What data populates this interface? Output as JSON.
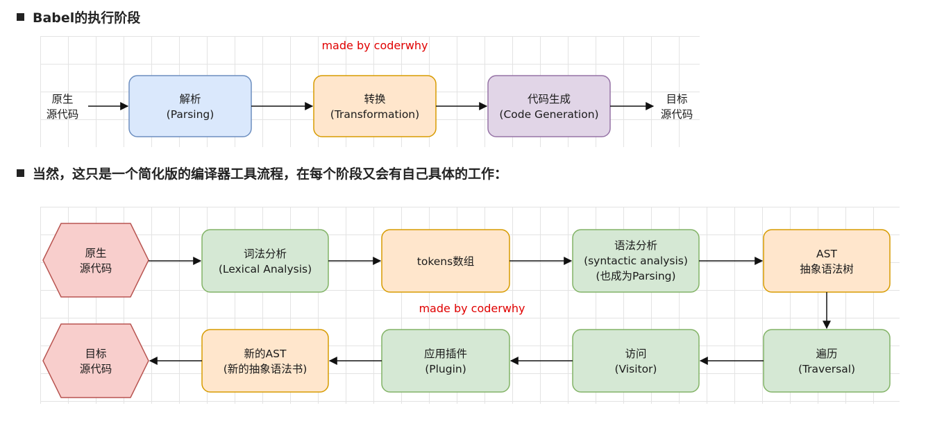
{
  "heading1": "Babel的执行阶段",
  "heading2": "当然，这只是一个简化版的编译器工具流程，在每个阶段又会有自己具体的工作：",
  "watermark": "made by coderwhy",
  "colors": {
    "blue_fill": "#dae8fc",
    "blue_stroke": "#6c8ebf",
    "orange_fill": "#ffe6cc",
    "orange_stroke": "#d79b00",
    "purple_fill": "#e1d5e7",
    "purple_stroke": "#9673a6",
    "green_fill": "#d5e8d4",
    "green_stroke": "#82b366",
    "pink_fill": "#f8cecc",
    "pink_stroke": "#b85450",
    "watermark": "#e00000"
  },
  "diagram1": {
    "input": [
      "原生",
      "源代码"
    ],
    "output": [
      "目标",
      "源代码"
    ],
    "stages": [
      {
        "line1": "解析",
        "line2": "(Parsing)"
      },
      {
        "line1": "转换",
        "line2": "(Transformation)"
      },
      {
        "line1": "代码生成",
        "line2": "(Code Generation)"
      }
    ]
  },
  "diagram2": {
    "source": [
      "原生",
      "源代码"
    ],
    "target": [
      "目标",
      "源代码"
    ],
    "row1": [
      {
        "lines": [
          "词法分析",
          "(Lexical Analysis)"
        ]
      },
      {
        "lines": [
          "tokens数组"
        ]
      },
      {
        "lines": [
          "语法分析",
          "(syntactic analysis)",
          "(也成为Parsing)"
        ]
      },
      {
        "lines": [
          "AST",
          "抽象语法树"
        ]
      }
    ],
    "row2": [
      {
        "lines": [
          "遍历",
          "(Traversal)"
        ]
      },
      {
        "lines": [
          "访问",
          "(Visitor)"
        ]
      },
      {
        "lines": [
          "应用插件",
          "(Plugin)"
        ]
      },
      {
        "lines": [
          "新的AST",
          "(新的抽象语法书)"
        ]
      }
    ]
  }
}
